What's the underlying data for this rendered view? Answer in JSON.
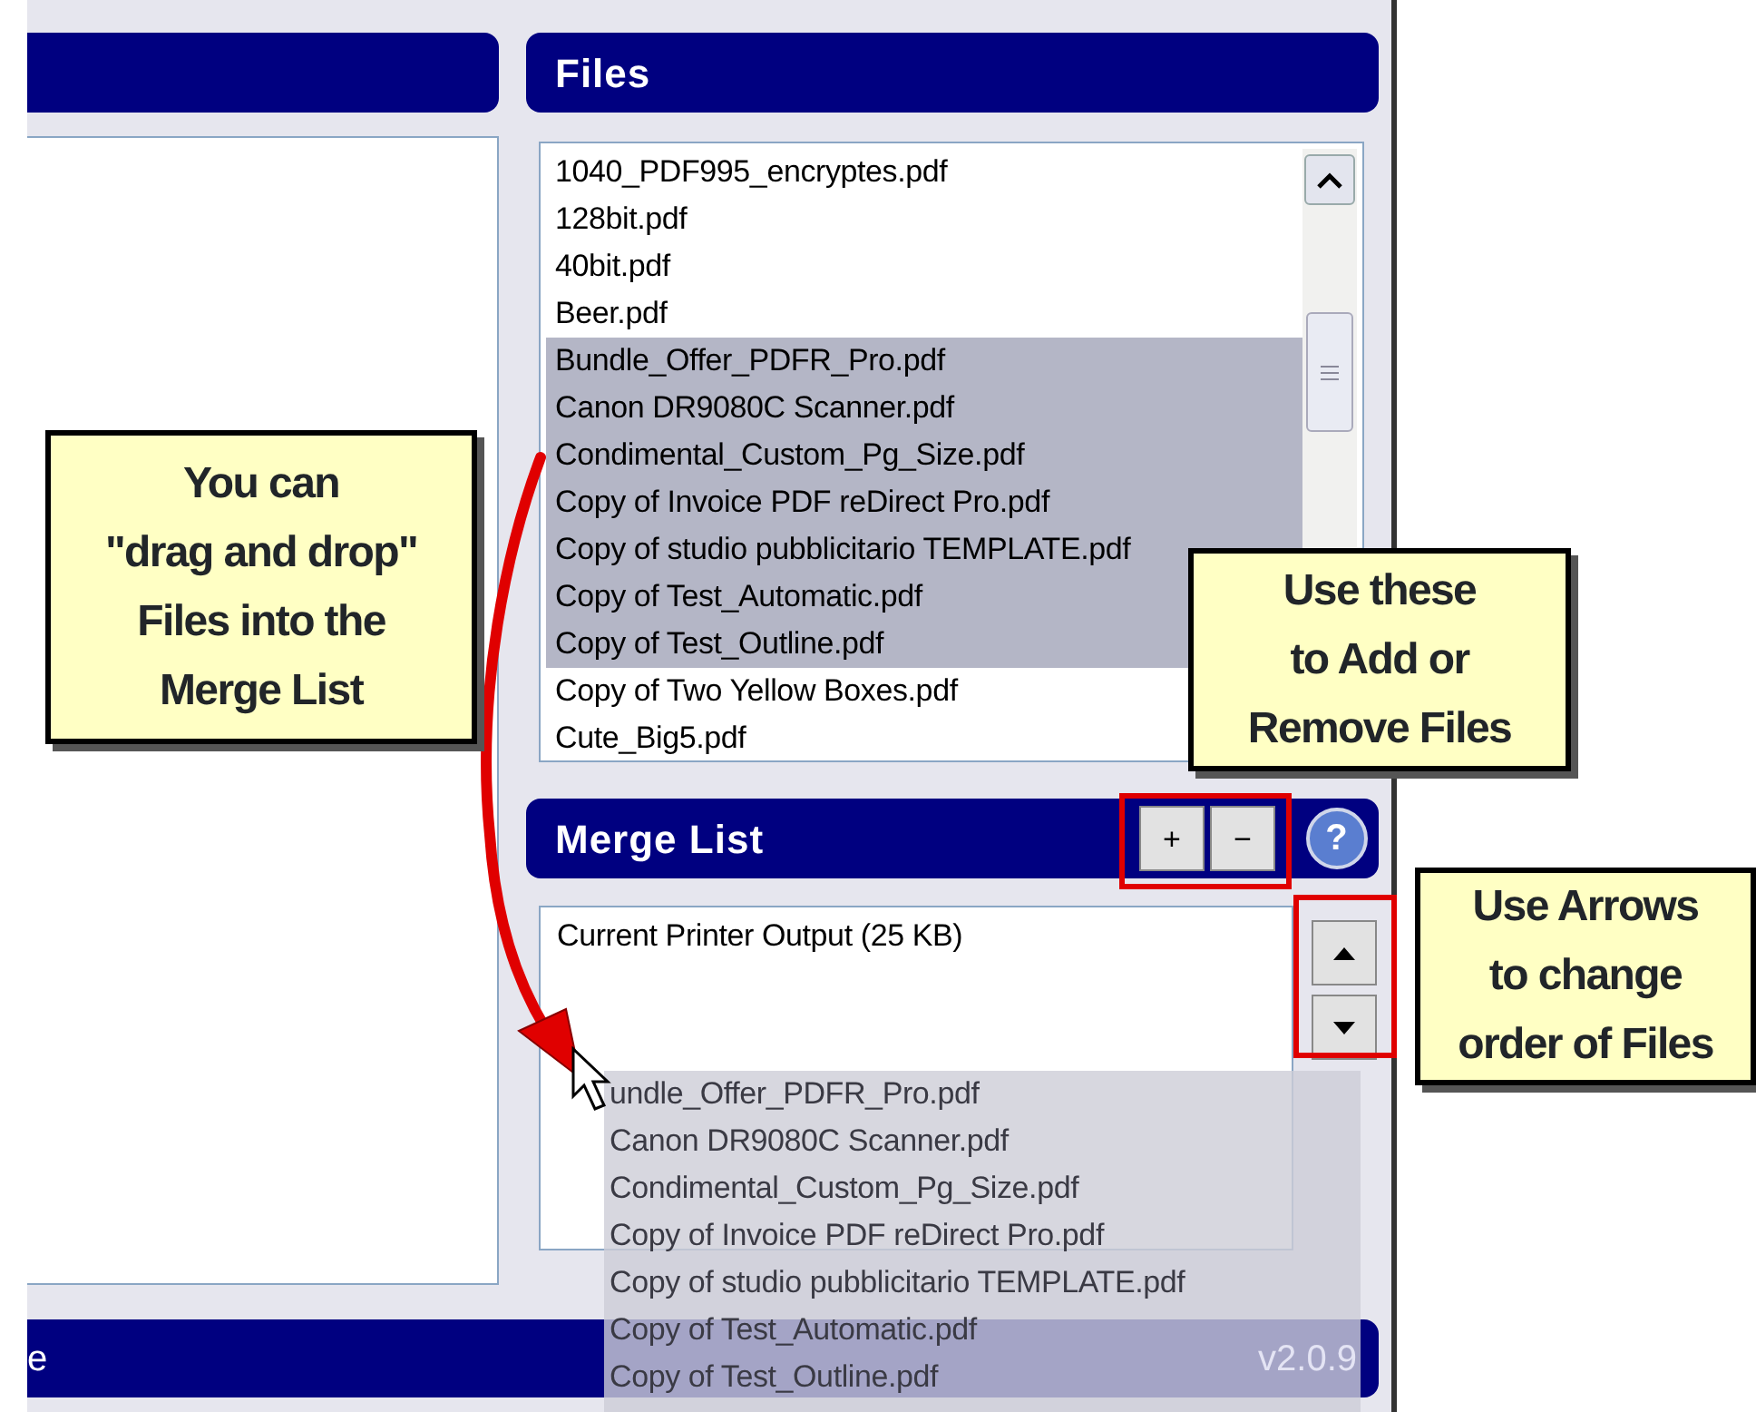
{
  "files": {
    "title": "Files",
    "items": [
      {
        "name": "1040_PDF995_encryptes.pdf",
        "selected": false
      },
      {
        "name": "128bit.pdf",
        "selected": false
      },
      {
        "name": "40bit.pdf",
        "selected": false
      },
      {
        "name": "Beer.pdf",
        "selected": false
      },
      {
        "name": "Bundle_Offer_PDFR_Pro.pdf",
        "selected": true
      },
      {
        "name": "Canon DR9080C Scanner.pdf",
        "selected": true
      },
      {
        "name": "Condimental_Custom_Pg_Size.pdf",
        "selected": true
      },
      {
        "name": "Copy of Invoice PDF reDirect Pro.pdf",
        "selected": true
      },
      {
        "name": "Copy of studio pubblicitario TEMPLATE.pdf",
        "selected": true
      },
      {
        "name": "Copy of Test_Automatic.pdf",
        "selected": true
      },
      {
        "name": "Copy of Test_Outline.pdf",
        "selected": true
      },
      {
        "name": "Copy of Two Yellow Boxes.pdf",
        "selected": false
      },
      {
        "name": "Cute_Big5.pdf",
        "selected": false
      }
    ]
  },
  "merge_list": {
    "title": "Merge List",
    "add_label": "+",
    "remove_label": "−",
    "help_label": "?",
    "items": [
      "Current Printer Output (25 KB)"
    ]
  },
  "status_bar": {
    "left_text": "e",
    "version": "v2.0.9"
  },
  "drag_ghost": {
    "items": [
      "undle_Offer_PDFR_Pro.pdf",
      "Canon DR9080C Scanner.pdf",
      "Condimental_Custom_Pg_Size.pdf",
      "Copy of Invoice PDF reDirect Pro.pdf",
      "Copy of studio pubblicitario TEMPLATE.pdf",
      "Copy of Test_Automatic.pdf",
      "Copy of Test_Outline.pdf"
    ]
  },
  "callouts": [
    {
      "kind": "drag",
      "lines": [
        "You can",
        "\"drag and drop\"",
        "Files into the",
        "Merge List"
      ]
    },
    {
      "kind": "add",
      "lines": [
        "Use these",
        "to Add or",
        "Remove Files"
      ]
    },
    {
      "kind": "arrows",
      "lines": [
        "Use Arrows",
        "to change",
        "order of Files"
      ]
    }
  ]
}
